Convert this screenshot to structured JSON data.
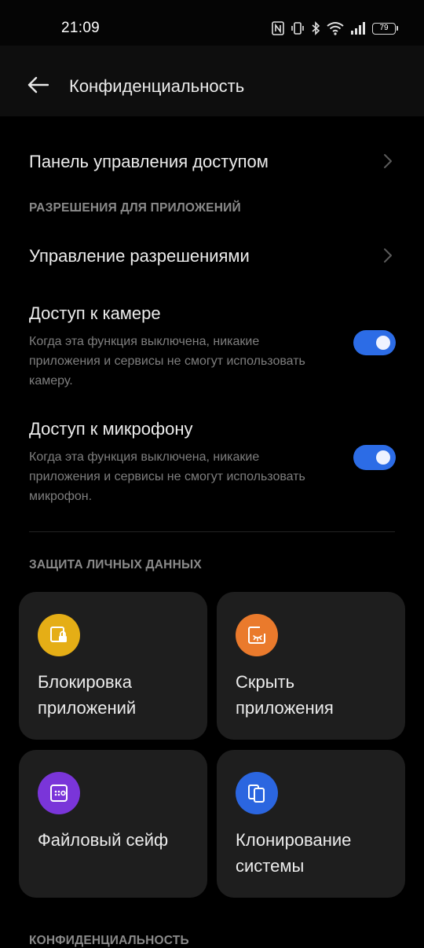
{
  "status_bar": {
    "time": "21:09",
    "battery": "79",
    "icons": [
      "nfc-icon",
      "vibrate-icon",
      "bluetooth-icon",
      "wifi-icon",
      "signal-icon",
      "battery-icon"
    ]
  },
  "header": {
    "title": "Конфиденциальность",
    "back_icon": "arrow-left-icon"
  },
  "rows": {
    "access_panel": "Панель управления доступом",
    "permissions_manage": "Управление разрешениями"
  },
  "sections": {
    "app_permissions": "РАЗРЕШЕНИЯ ДЛЯ ПРИЛОЖЕНИЙ",
    "personal_data": "ЗАЩИТА ЛИЧНЫХ ДАННЫХ",
    "privacy_partial": "КОНФИДЕНЦИАЛЬНОСТЬ"
  },
  "toggles": {
    "camera": {
      "title": "Доступ к камере",
      "description": "Когда эта функция выключена, никакие приложения и сервисы не смогут использовать камеру.",
      "enabled": true
    },
    "microphone": {
      "title": "Доступ к микрофону",
      "description": "Когда эта функция выключена, никакие приложения и сервисы не смогут использовать микрофон.",
      "enabled": true
    }
  },
  "tiles": [
    {
      "label": "Блокировка приложений",
      "icon": "app-lock-icon",
      "color": "#e5ae16"
    },
    {
      "label": "Скрыть приложения",
      "icon": "hide-apps-icon",
      "color": "#ea7a2c"
    },
    {
      "label": "Файловый сейф",
      "icon": "file-safe-icon",
      "color": "#7a35d9"
    },
    {
      "label": "Клонирование системы",
      "icon": "system-clone-icon",
      "color": "#2b66e0"
    }
  ],
  "colors": {
    "background": "#000000",
    "accent": "#2c6ce6",
    "tile_background": "#1e1e1e",
    "secondary_text": "#7e7e7e"
  }
}
